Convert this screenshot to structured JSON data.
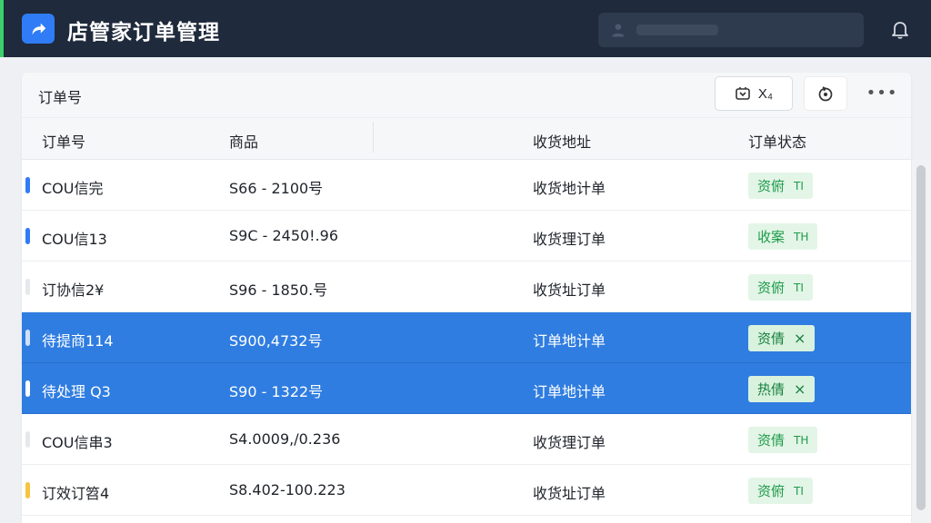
{
  "app": {
    "title": "店管家订单管理"
  },
  "card": {
    "title": "订单号",
    "export_label": "X₄"
  },
  "columns": [
    "订单号",
    "商品",
    "收货地址",
    "订单状态"
  ],
  "rows": [
    {
      "id": "COU信完",
      "goods": "S66 - 2100号",
      "address": "收货地计单",
      "status": "资俯",
      "status_mark": "TI",
      "marker_color": "#2f7cf6",
      "selected": false
    },
    {
      "id": "COU信13",
      "goods": "S9C - 2450!.96",
      "address": "收货理订单",
      "status": "收案",
      "status_mark": "TH",
      "marker_color": "#2f7cf6",
      "selected": false
    },
    {
      "id": "订协信2¥",
      "goods": "S96 - 1850.号",
      "address": "收货址订单",
      "status": "资俯",
      "status_mark": "TI",
      "marker_color": "#e6e8eb",
      "selected": false
    },
    {
      "id": "待提商114",
      "goods": "S900,4732号",
      "address": "订单地计单",
      "status": "资倩",
      "status_mark": "×",
      "marker_color": "#cfe0f7",
      "selected": true
    },
    {
      "id": "待处理 Q3",
      "goods": "S90 - 1322号",
      "address": "订单地计单",
      "status": "热倩",
      "status_mark": "×",
      "marker_color": "#ffffff",
      "selected": true
    },
    {
      "id": "COU信串3",
      "goods": "S4.0009,/0.236",
      "address": "收货理订单",
      "status": "资倩",
      "status_mark": "TH",
      "marker_color": "#e6e8eb",
      "selected": false
    },
    {
      "id": "订效订笤4",
      "goods": "S8.402-100.223",
      "address": "收货址订单",
      "status": "资俯",
      "status_mark": "TI",
      "marker_color": "#f5c542",
      "selected": false
    }
  ]
}
